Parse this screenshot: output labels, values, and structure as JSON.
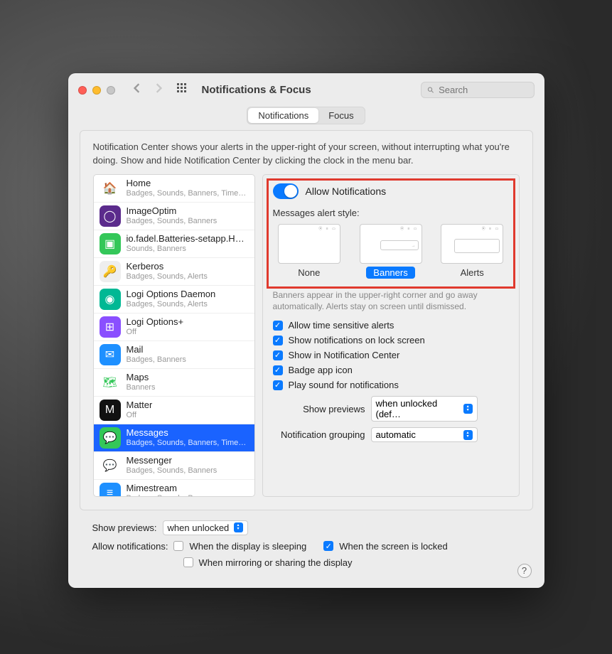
{
  "window": {
    "title": "Notifications & Focus",
    "search_placeholder": "Search"
  },
  "tabs": {
    "notifications": "Notifications",
    "focus": "Focus"
  },
  "description": "Notification Center shows your alerts in the upper-right of your screen, without interrupting what you're doing. Show and hide Notification Center by clicking the clock in the menu bar.",
  "apps": [
    {
      "name": "Home",
      "sub": "Badges, Sounds, Banners, Time…",
      "bg": "#ffffff",
      "icon": "🏠",
      "txt": "#ff9500"
    },
    {
      "name": "ImageOptim",
      "sub": "Badges, Sounds, Banners",
      "bg": "#5b2b8c",
      "icon": "◯"
    },
    {
      "name": "io.fadel.Batteries-setapp.H…",
      "sub": "Sounds, Banners",
      "bg": "#34c759",
      "icon": "▣"
    },
    {
      "name": "Kerberos",
      "sub": "Badges, Sounds, Alerts",
      "bg": "#eeeeee",
      "icon": "🔑",
      "txt": "#b8860b"
    },
    {
      "name": "Logi Options Daemon",
      "sub": "Badges, Sounds, Alerts",
      "bg": "#00b894",
      "icon": "◉"
    },
    {
      "name": "Logi Options+",
      "sub": "Off",
      "bg": "#8a4fff",
      "icon": "⊞"
    },
    {
      "name": "Mail",
      "sub": "Badges, Banners",
      "bg": "#1e90ff",
      "icon": "✉"
    },
    {
      "name": "Maps",
      "sub": "Banners",
      "bg": "#ffffff",
      "icon": "🗺",
      "txt": "#34c759"
    },
    {
      "name": "Matter",
      "sub": "Off",
      "bg": "#111111",
      "icon": "M"
    },
    {
      "name": "Messages",
      "sub": "Badges, Sounds, Banners, Time…",
      "bg": "#34c759",
      "icon": "💬",
      "selected": true
    },
    {
      "name": "Messenger",
      "sub": "Badges, Sounds, Banners",
      "bg": "#ffffff",
      "icon": "💬",
      "txt": "#a040ff"
    },
    {
      "name": "Mimestream",
      "sub": "Badges, Sounds, Banners",
      "bg": "#1e90ff",
      "icon": "≡"
    }
  ],
  "detail": {
    "allow": "Allow Notifications",
    "alert_style_label": "Messages alert style:",
    "styles": {
      "none": "None",
      "banners": "Banners",
      "alerts": "Alerts"
    },
    "style_desc": "Banners appear in the upper-right corner and go away automatically. Alerts stay on screen until dismissed.",
    "checks": {
      "time_sensitive": "Allow time sensitive alerts",
      "lock_screen": "Show notifications on lock screen",
      "notif_center": "Show in Notification Center",
      "badge": "Badge app icon",
      "sound": "Play sound for notifications"
    },
    "previews_label": "Show previews",
    "previews_value": "when unlocked (def…",
    "grouping_label": "Notification grouping",
    "grouping_value": "automatic"
  },
  "footer": {
    "show_previews_label": "Show previews:",
    "show_previews_value": "when unlocked",
    "allow_label": "Allow notifications:",
    "display_sleeping": "When the display is sleeping",
    "screen_locked": "When the screen is locked",
    "mirroring": "When mirroring or sharing the display"
  }
}
